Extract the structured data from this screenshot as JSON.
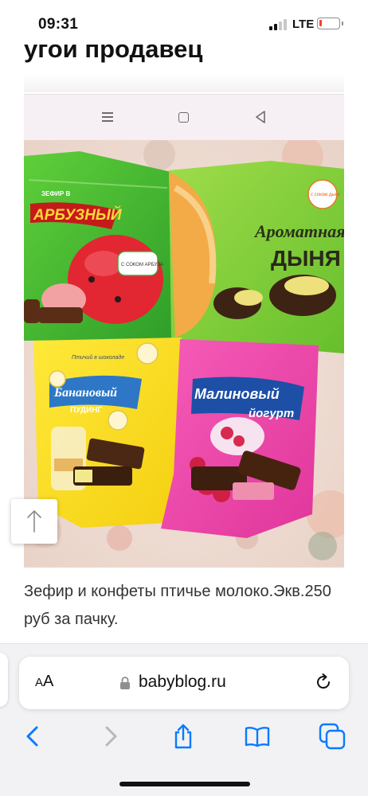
{
  "status_bar": {
    "time": "09:31",
    "network": "LTE",
    "battery_level": 0.15,
    "battery_color": "#ff3b30"
  },
  "page": {
    "heading": "угои продавец",
    "caption": "Зефир и конфеты птичье молоко.Экв.250 руб за пачку."
  },
  "photo": {
    "package_labels": {
      "watermelon_brand": "ЗЕФИР В",
      "watermelon_title": "АРБУЗНЫЙ",
      "watermelon_badge": "С СОКОМ АРБУЗА",
      "melon_title_1": "Ароматная",
      "melon_title_2": "ДЫНЯ",
      "melon_badge": "с соком дыни",
      "banana_brand": "Птичий в шоколаде",
      "banana_title_1": "Банановый",
      "banana_title_2": "ПУДИНГ",
      "raspberry_title_1": "Малиновый",
      "raspberry_title_2": "йогурт"
    }
  },
  "browser": {
    "url": "babyblog.ru",
    "text_size_button": "AA"
  },
  "colors": {
    "accent_blue": "#0a7aff",
    "disabled_gray": "#b8b8bc",
    "toolbar_bg": "#f2f2f4"
  },
  "icons": {
    "scroll_top": "arrow-up-icon",
    "lock": "lock-icon",
    "reload": "reload-icon",
    "back": "chevron-left-icon",
    "forward": "chevron-right-icon",
    "share": "share-icon",
    "bookmarks": "book-icon",
    "tabs": "tabs-icon"
  }
}
